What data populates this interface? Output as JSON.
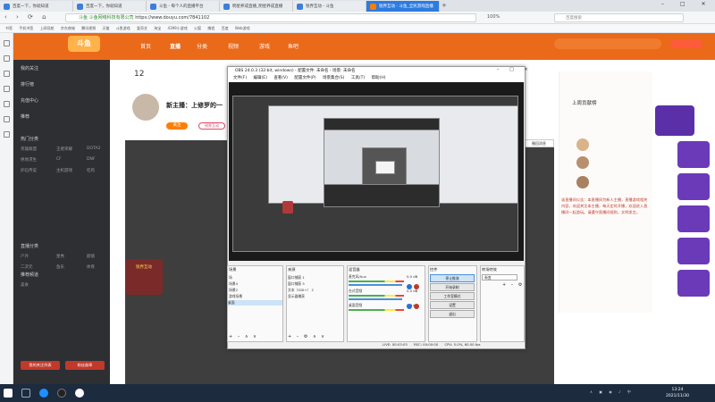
{
  "browser": {
    "tabs": [
      {
        "label": "百度一下，你就知道",
        "active": false
      },
      {
        "label": "百度一下，你就知道",
        "active": false
      },
      {
        "label": "斗鱼 - 每个人的直播平台",
        "active": false
      },
      {
        "label": "明星养成直播_明星养成直播",
        "active": false
      },
      {
        "label": "锐界互动 - 斗鱼",
        "active": false
      },
      {
        "label": "锐界互动 - 斗鱼_全民游戏直播",
        "active": true
      }
    ],
    "url": "https://www.douyu.com/7841102",
    "url_prefix": "斗鱼 斗鱼网络科技有限公司",
    "search_placeholder": "百度搜索",
    "zoom": "100%",
    "bookmarks": [
      "书签",
      "手机书签",
      "上网导航",
      "京东商城",
      "腾讯视频",
      "天猫",
      "斗鱼游戏",
      "爱奇艺",
      "淘宝",
      "4399小游戏",
      "火狐",
      "携程",
      "百度",
      "Web游戏"
    ]
  },
  "douyu": {
    "logo": "斗鱼",
    "nav": [
      "首页",
      "直播",
      "分类",
      "视频",
      "游戏",
      "鱼吧"
    ],
    "sidebar": {
      "sections": [
        "我的关注",
        "排行榜",
        "充值中心",
        "推荐",
        "热门分类",
        "直播分类",
        "推荐频道"
      ],
      "items": [
        "英雄联盟",
        "王者荣耀",
        "DOTA2",
        "绝地求生",
        "CF",
        "DNF",
        "炉石传说",
        "主机游戏",
        "吃鸡",
        "户外",
        "星秀",
        "颜值",
        "二次元",
        "鱼乐",
        "体育",
        "美食"
      ],
      "buttons": [
        "我的关注列表",
        "粉丝勋章"
      ]
    },
    "room": {
      "count": "12",
      "streamer_title": "新主播：上修罗的一",
      "follow": "关注",
      "subtitle": "锐界互动"
    },
    "right_panel": {
      "header": "上周贡献榜",
      "text": "该直播间公告：本直播间为新人主播，直播游戏相关内容，欢迎关注本主播，每天定时开播，欢迎进入直播间一起游玩。请遵守直播间规则，文明发言。",
      "popup": "撤回消息"
    },
    "player_overlay": "锐界互动"
  },
  "obs": {
    "title": "OBS 24.0.3 (32-bit, windows) - 配置文件: 未命名 - 场景: 未命名",
    "menu": [
      "文件(F)",
      "编辑(E)",
      "查看(V)",
      "配置文件(P)",
      "场景集合(S)",
      "工具(T)",
      "帮助(H)"
    ],
    "docks": {
      "scenes": {
        "title": "场景",
        "items": [
          "场",
          "场景4",
          "场景2",
          "游戏场景",
          "桌面"
        ]
      },
      "sources": {
        "title": "来源",
        "items": [
          "窗口捕获 1",
          "窗口捕获 5",
          "文本（GDI+） 2",
          "显示器捕获"
        ]
      },
      "mixer": {
        "title": "混音器",
        "items": [
          "麦克风/Aux",
          "台式音频",
          "桌面音频"
        ],
        "levels": [
          "0.0 dB",
          "0.0 dB",
          "0.0 dB"
        ]
      },
      "transitions": {
        "title": "转场特效",
        "items": [
          "渐变",
          "淡出",
          "时长"
        ]
      },
      "controls": {
        "title": "控件",
        "buttons": [
          "停止推流",
          "开始录制",
          "工作室模式",
          "设置",
          "退出"
        ]
      }
    },
    "status": [
      "LIVE: 00:03:03",
      "REC: 00:00:00",
      "CPU: 5.0%, 60.00 fps"
    ]
  },
  "taskbar": {
    "time": "13:24",
    "date": "2021/11/30"
  }
}
